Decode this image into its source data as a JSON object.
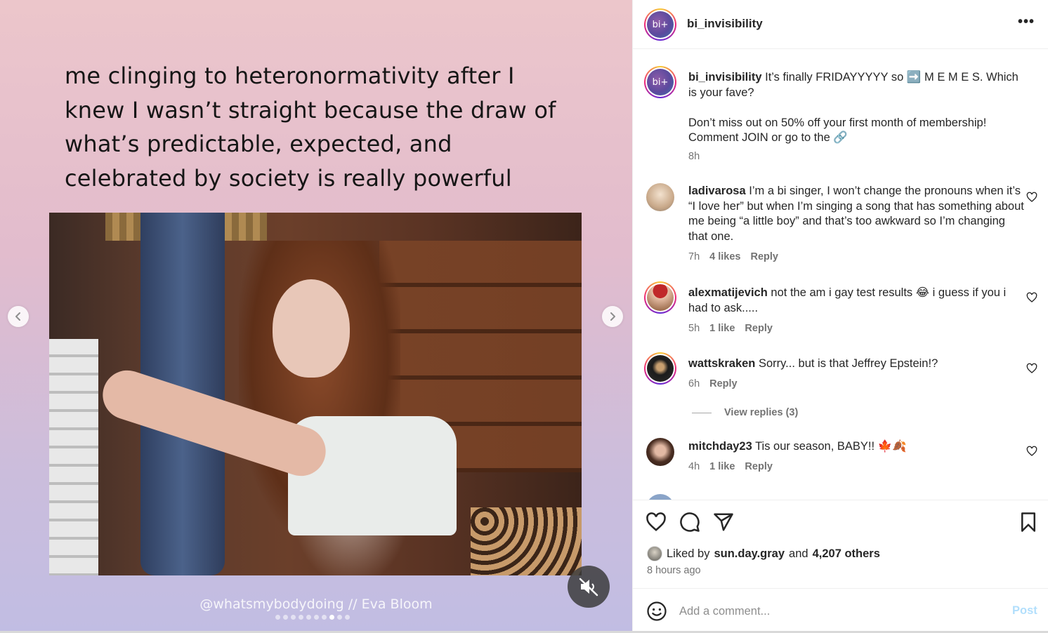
{
  "post": {
    "meme_text": "me clinging to heteronormativity after I knew I wasn’t straight because the draw of what’s predictable, expected, and celebrated by society is really powerful",
    "credit": "@whatsmybodydoing // Eva Bloom",
    "carousel": {
      "total": 10,
      "active_index": 7
    },
    "mute_icon": "speaker-muted-icon",
    "colors": {
      "bg_top": "#ecc6cb",
      "bg_bottom": "#c1bde3"
    }
  },
  "header": {
    "avatar_text": "bi+",
    "username": "bi_invisibility",
    "more": "•••"
  },
  "caption": {
    "username": "bi_invisibility",
    "text_1": "It’s finally FRIDAYYYYY so ➡️ M E M E S. Which is your fave?",
    "text_2": "Don’t miss out on 50% off your first month of membership! Comment JOIN or go to the 🔗",
    "time": "8h"
  },
  "comments": [
    {
      "username": "ladivarosa",
      "text": "I’m a bi singer, I won’t change the pronouns when it’s “I love her” but when I’m singing a song that has something about me being “a little boy” and that’s too awkward so I’m changing that one.",
      "time": "7h",
      "likes": "4 likes",
      "reply": "Reply"
    },
    {
      "username": "alexmatijevich",
      "text": "not the am i gay test results 😂 i guess if you i had to ask.....",
      "time": "5h",
      "likes": "1 like",
      "reply": "Reply"
    },
    {
      "username": "wattskraken",
      "text": "Sorry... but is that Jeffrey Epstein!?",
      "time": "6h",
      "likes": "",
      "reply": "Reply",
      "view_replies": "View replies (3)"
    },
    {
      "username": "mitchday23",
      "text": "Tis our season, BABY!! 🍁🍂",
      "time": "4h",
      "likes": "1 like",
      "reply": "Reply"
    }
  ],
  "actions": {
    "like_icon": "heart-icon",
    "comment_icon": "comment-bubble-icon",
    "share_icon": "paper-plane-icon",
    "save_icon": "bookmark-icon"
  },
  "likes": {
    "prefix": "Liked by",
    "user": "sun.day.gray",
    "and": "and",
    "others": "4,207 others",
    "time_ago": "8 hours ago"
  },
  "add_comment": {
    "placeholder": "Add a comment...",
    "post_label": "Post",
    "emoji_icon": "smiley-icon"
  }
}
